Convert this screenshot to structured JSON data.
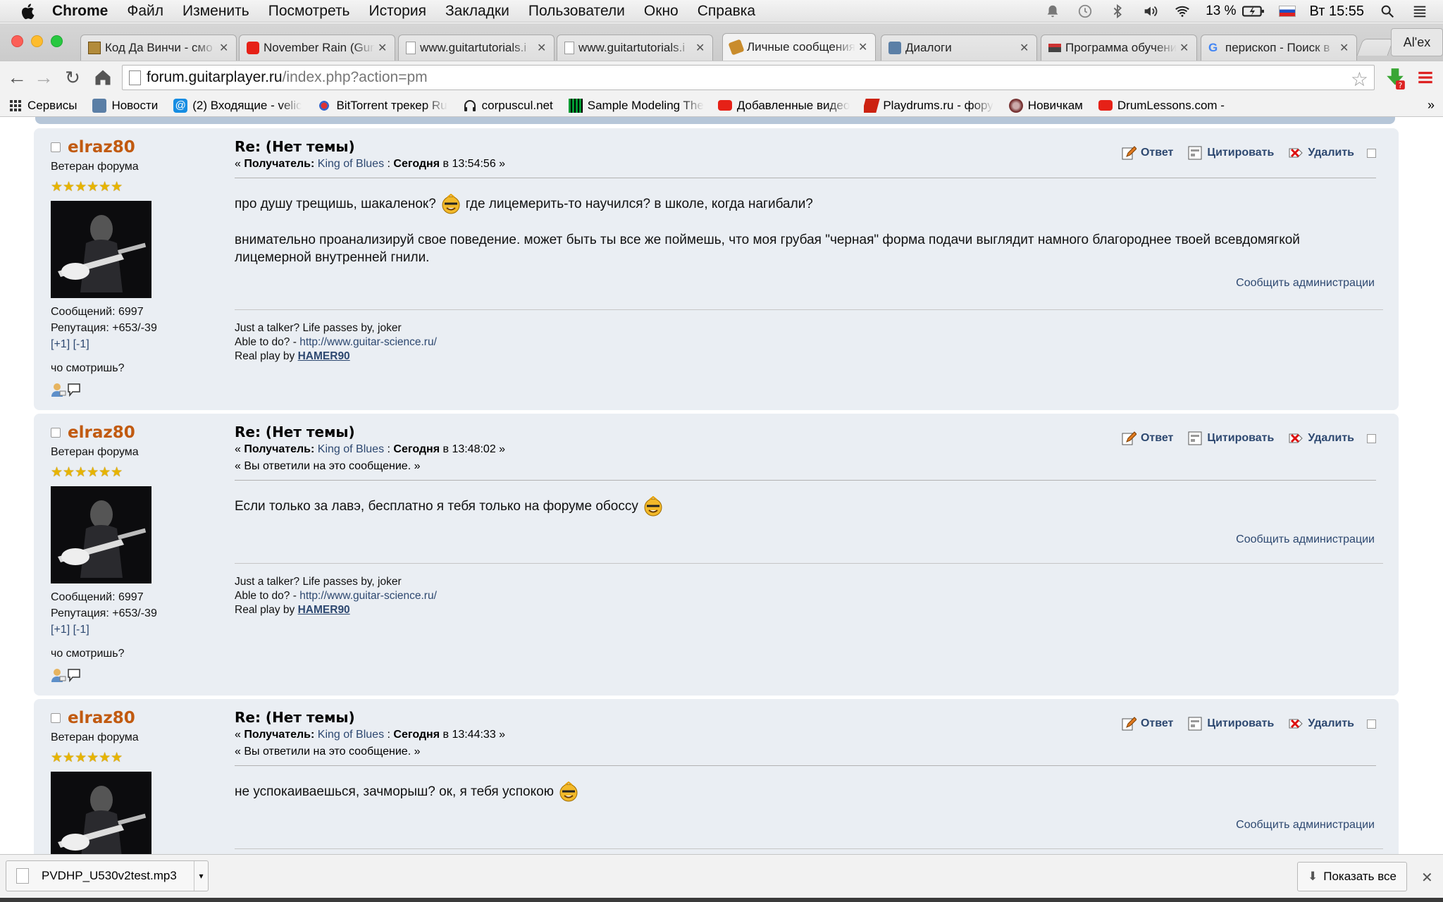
{
  "menubar": {
    "app": "Chrome",
    "items": [
      "Файл",
      "Изменить",
      "Посмотреть",
      "История",
      "Закладки",
      "Пользователи",
      "Окно",
      "Справка"
    ],
    "battery": "13 %",
    "clock": "Вт 15:55"
  },
  "tabs": [
    {
      "title": "Код Да Винчи - смо",
      "icon": "video-site-icon"
    },
    {
      "title": "November Rain (Gun",
      "icon": "youtube-icon"
    },
    {
      "title": "www.guitartutorials.i",
      "icon": "page-icon"
    },
    {
      "title": "www.guitartutorials.i",
      "icon": "page-icon"
    },
    {
      "title": "Личные сообщения",
      "icon": "forum-icon"
    },
    {
      "title": "Диалоги",
      "icon": "vk-icon"
    },
    {
      "title": "Программа обучени",
      "icon": "flag-icon"
    },
    {
      "title": "перископ - Поиск в",
      "icon": "google-icon"
    }
  ],
  "profile": "Al'ex",
  "address": {
    "host": "forum.guitarplayer.ru",
    "path": "/index.php?action=pm"
  },
  "bookmarks": [
    {
      "label": "Сервисы",
      "icon": "apps-icon"
    },
    {
      "label": "Новости",
      "icon": "vk-icon"
    },
    {
      "label": "(2) Входящие - velic",
      "icon": "mail-icon"
    },
    {
      "label": "BitTorrent трекер Ru",
      "icon": "torrent-icon"
    },
    {
      "label": "corpuscul.net",
      "icon": "headphones-icon"
    },
    {
      "label": "Sample Modeling The",
      "icon": "bars-icon"
    },
    {
      "label": "Добавленные видео",
      "icon": "youtube-icon"
    },
    {
      "label": "Playdrums.ru - фору",
      "icon": "drums-icon"
    },
    {
      "label": "Новичкам",
      "icon": "drum-icon"
    },
    {
      "label": "DrumLessons.com -",
      "icon": "youtube-icon"
    }
  ],
  "labels": {
    "reply": "Ответ",
    "quote": "Цитировать",
    "delete": "Удалить",
    "report": "Сообщить администрации",
    "recipient_label": "Получатель:",
    "today": "Сегодня",
    "at": "в",
    "answered": "« Вы ответили на это сообщение. »"
  },
  "author": {
    "name": "elraz80",
    "rank": "Ветеран форума",
    "posts": "Сообщений: 6997",
    "reputation": "Репутация: +653/-39",
    "rep_plus": "[+1]",
    "rep_minus": "[-1]",
    "status": "чо смотришь?"
  },
  "signature": {
    "line1": "Just a talker? Life passes by, joker",
    "line2_prefix": "Able to do? - ",
    "line2_link": "http://www.guitar-science.ru/",
    "line3_prefix": "Real play by ",
    "line3_link": "HAMER90"
  },
  "messages": [
    {
      "subject": "Re: (Нет темы)",
      "recipient": "King of Blues",
      "time": "13:54:56",
      "p1_before": "про душу трещишь, шакаленок?",
      "p1_after": "где лицемерить-то научился? в школе, когда нагибали?",
      "p2": "внимательно проанализируй свое поведение. может быть ты все же поймешь, что моя грубая \"черная\" форма подачи выглядит намного благороднее твоей всевдомягкой лицемерной внутренней гнили."
    },
    {
      "subject": "Re: (Нет темы)",
      "recipient": "King of Blues",
      "time": "13:48:02",
      "text": "Если только за лавэ, бесплатно я тебя только на форуме обоссу"
    },
    {
      "subject": "Re: (Нет темы)",
      "recipient": "King of Blues",
      "time": "13:44:33",
      "text": "не успокаиваешься, зачморыш? ок, я тебя успокою"
    }
  ],
  "download": {
    "file": "PVDHP_U530v2test.mp3",
    "show_all": "Показать все"
  }
}
